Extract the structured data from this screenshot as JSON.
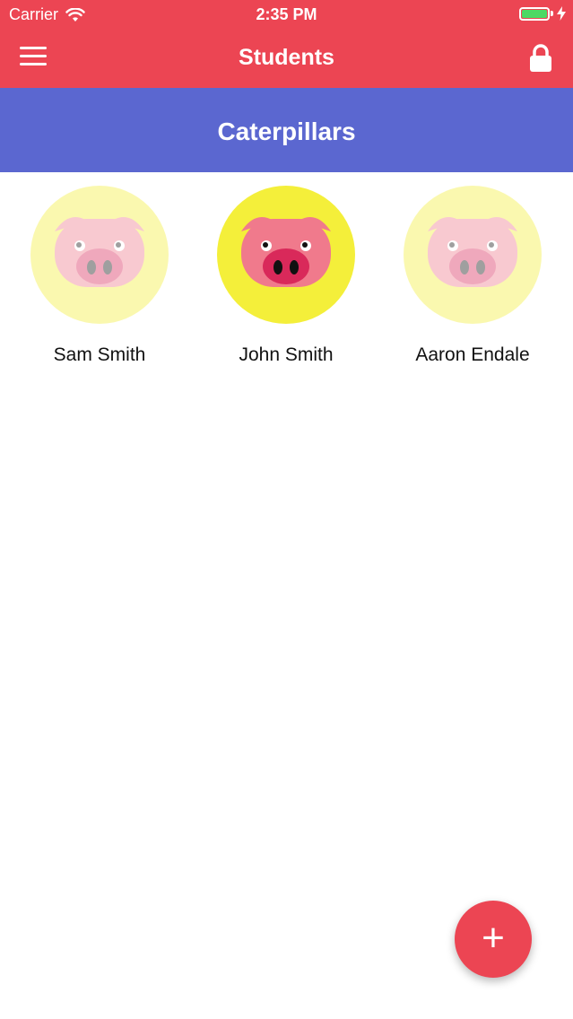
{
  "status_bar": {
    "carrier": "Carrier",
    "time": "2:35 PM",
    "battery_level": 1.0,
    "icons": [
      "wifi-icon",
      "battery-icon",
      "charging-bolt-icon"
    ]
  },
  "nav": {
    "title": "Students",
    "menu_icon": "hamburger-menu-icon",
    "lock_icon": "lock-icon"
  },
  "section": {
    "title": "Caterpillars"
  },
  "students": [
    {
      "name": "Sam Smith",
      "avatar_icon": "pig-icon",
      "selected": false
    },
    {
      "name": "John Smith",
      "avatar_icon": "pig-icon",
      "selected": true
    },
    {
      "name": "Aaron Endale",
      "avatar_icon": "pig-icon",
      "selected": false
    }
  ],
  "fab": {
    "label": "+",
    "icon": "add-icon"
  },
  "colors": {
    "primary": "#ec4553",
    "section": "#5b67d0",
    "avatar_bg": "#f4ef3a",
    "pig": "#f07a8c",
    "snout": "#d9295a"
  }
}
